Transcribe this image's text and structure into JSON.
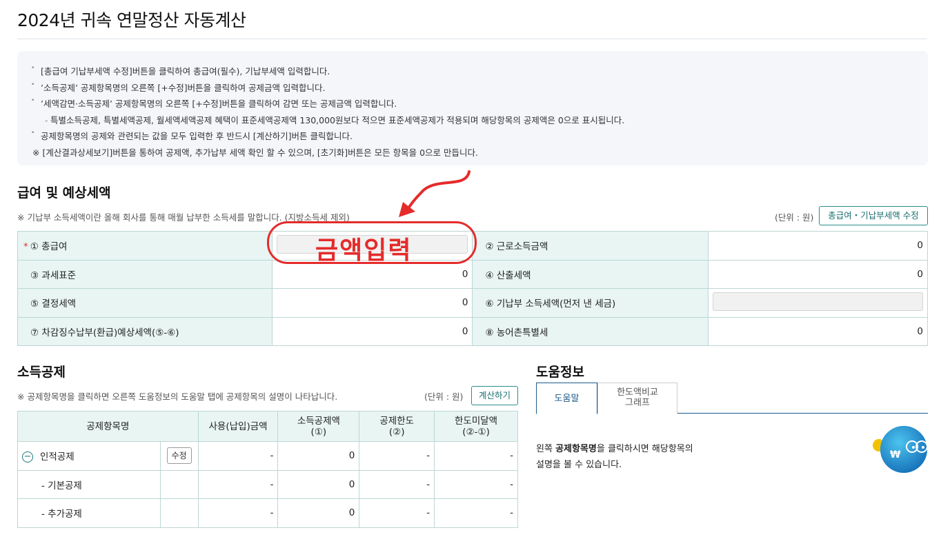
{
  "page": {
    "title": "2024년 귀속 연말정산 자동계산"
  },
  "guide": {
    "lines": [
      "[총급여 기납부세액 수정]버튼을 클릭하여 총급여(필수), 기납부세액 입력합니다.",
      "’소득공제’ 공제항목명의 오른쪽 [+수정]버튼을 클릭하여 공제금액 입력합니다.",
      "’세액감면·소득공제’ 공제항목명의 오른쪽 [+수정]버튼을 클릭하여 감면 또는 공제금액 입력합니다.",
      "특별소득공제, 특별세액공제, 월세액세액공제 혜택이 표준세액공제액 130,000원보다 적으면 표준세액공제가 적용되며 해당항목의 공제액은 0으로 표시됩니다.",
      "공제항목명의 공제와 관련되는 값을 모두 입력한 후 반드시 [계산하기]버튼 클릭합니다.",
      "※ [계산결과상세보기]버튼을 통하여 공제액, 추가납부 세액 확인 할 수 있으며, [초기화]버튼은 모든 항목을 0으로 만듭니다."
    ]
  },
  "salary": {
    "heading": "급여 및 예상세액",
    "note": "※ 기납부 소득세액이란 올해 회사를 통해 매월 납부한 소득세를 말합니다. (지방소득세 제외)",
    "unit": "(단위 : 원)",
    "edit_button": "총급여・기납부세액 수정",
    "required_mark": "*",
    "rows": [
      {
        "l1": "① 총급여",
        "v1": "",
        "l2": "② 근로소득금액",
        "v2": "0"
      },
      {
        "l1": "③ 과세표준",
        "v1": "0",
        "l2": "④ 산출세액",
        "v2": "0"
      },
      {
        "l1": "⑤ 결정세액",
        "v1": "0",
        "l2": "⑥ 기납부 소득세액(먼저 낸 세금)",
        "v2": ""
      },
      {
        "l1": "⑦ 차감징수납부(환급)예상세액(⑤-⑥)",
        "v1": "0",
        "l2": "⑧ 농어촌특별세",
        "v2": "0"
      }
    ]
  },
  "annotation": {
    "text": "금액입력"
  },
  "deduction": {
    "heading": "소득공제",
    "note": "※ 공제항목명을 클릭하면 오른쪽 도움정보의 도움말 탭에 공제항목의 설명이 나타납니다.",
    "unit": "(단위 : 원)",
    "calc_button": "계산하기",
    "headers": {
      "name": "공제항목명",
      "used": "사용(납입)금액",
      "amount": "소득공제액",
      "amount_sub": "(①)",
      "limit": "공제한도",
      "limit_sub": "(②)",
      "under": "한도미달액",
      "under_sub": "(②-①)"
    },
    "edit_label": "수정",
    "rows": [
      {
        "name": "인적공제",
        "used": "-",
        "amount": "0",
        "limit": "-",
        "under": "-"
      },
      {
        "name": "- 기본공제",
        "used": "-",
        "amount": "0",
        "limit": "-",
        "under": "-"
      },
      {
        "name": "- 추가공제",
        "used": "-",
        "amount": "0",
        "limit": "-",
        "under": "-"
      }
    ]
  },
  "help": {
    "heading": "도움정보",
    "tabs": [
      {
        "label": "도움말"
      },
      {
        "label": "한도액비교 그래프"
      }
    ],
    "text_prefix": "왼쪽 ",
    "text_bold": "공제항목명",
    "text_suffix_1": "을 클릭하시면 해당항목의",
    "text_line2": "설명을 볼 수 있습니다.",
    "mascot_symbol": "₩"
  }
}
